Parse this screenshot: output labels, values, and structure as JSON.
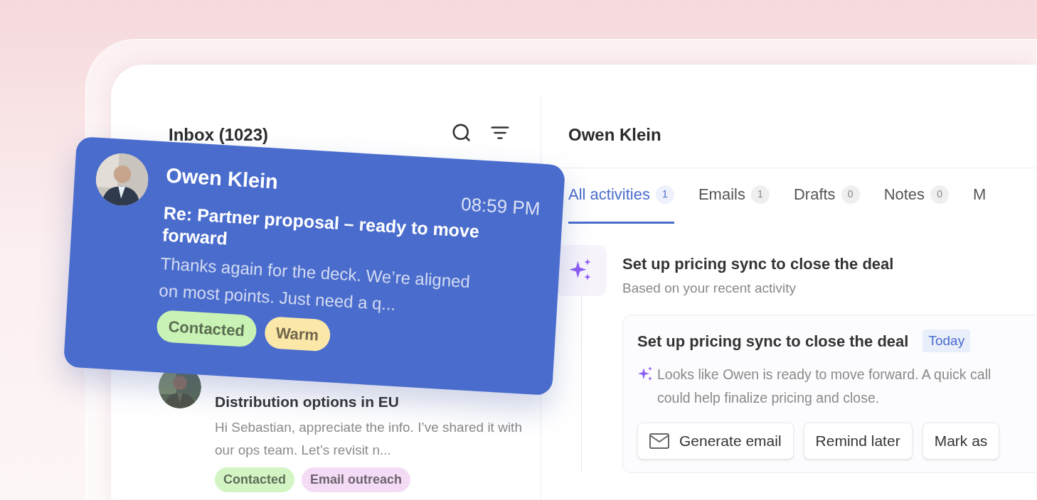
{
  "inbox": {
    "title": "Inbox (1023)",
    "messages": [
      {
        "sender": "Owen Klein",
        "time": "08:59 PM",
        "subject": "Re: Partner proposal – ready to move forward",
        "preview": "Thanks again for the deck. We’re aligned on most points. Just need a q...",
        "floating": true,
        "tags": [
          {
            "label": "Contacted",
            "color": "#c9f2b5"
          },
          {
            "label": "Warm",
            "color": "#fbe8a9"
          }
        ]
      },
      {
        "subject": "Distribution options in EU",
        "preview": "Hi Sebastian, appreciate the info. I’ve shared it with our ops team. Let’s revisit n...",
        "floating": false,
        "tags": [
          {
            "label": "Contacted",
            "color": "#d3f5c4"
          },
          {
            "label": "Email outreach",
            "color": "#f4dcf6"
          }
        ]
      }
    ]
  },
  "contact": {
    "name": "Owen Klein",
    "tabs": [
      {
        "label": "All activities",
        "count": "1",
        "selected": true
      },
      {
        "label": "Emails",
        "count": "1",
        "selected": false
      },
      {
        "label": "Drafts",
        "count": "0",
        "selected": false
      },
      {
        "label": "Notes",
        "count": "0",
        "selected": false
      },
      {
        "label": "M",
        "selected": false
      }
    ],
    "suggestion": {
      "title": "Set up pricing sync to close the deal",
      "subtitle": "Based on your recent activity"
    },
    "task": {
      "title": "Set up pricing sync to close the deal",
      "badge": "Today",
      "message": "Looks like Owen is ready to move forward. A quick call could help finalize pricing and close.",
      "actions": [
        {
          "label": "Generate email",
          "kind": "email"
        },
        {
          "label": "Remind later",
          "kind": "plain"
        },
        {
          "label": "Mark as",
          "kind": "plain"
        }
      ]
    }
  }
}
